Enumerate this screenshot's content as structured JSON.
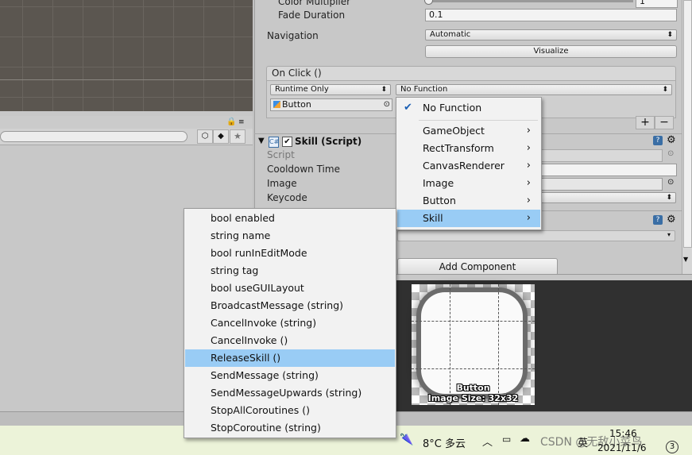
{
  "inspector": {
    "color_multiplier_label": "Color Multiplier",
    "color_multiplier_value": "1",
    "fade_duration_label": "Fade Duration",
    "fade_duration_value": "0.1",
    "navigation_label": "Navigation",
    "navigation_value": "Automatic",
    "visualize_label": "Visualize",
    "on_click_label": "On Click ()",
    "runtime_value": "Runtime Only",
    "function_value": "No Function",
    "object_value": "Button",
    "add_label": "+",
    "remove_label": "−",
    "component_title": "Skill (Script)",
    "fields": [
      "Script",
      "Cooldown Time",
      "Image",
      "Keycode"
    ],
    "add_component_label": "Add Component"
  },
  "function_menu": {
    "checked_item": "No Function",
    "items": [
      "GameObject",
      "RectTransform",
      "CanvasRenderer",
      "Image",
      "Button",
      "Skill"
    ],
    "selected_index": 5
  },
  "method_menu": {
    "items": [
      "bool enabled",
      "string name",
      "bool runInEditMode",
      "string tag",
      "bool useGUILayout",
      "BroadcastMessage (string)",
      "CancelInvoke (string)",
      "CancelInvoke ()",
      "ReleaseSkill ()",
      "SendMessage (string)",
      "SendMessageUpwards (string)",
      "StopAllCoroutines ()",
      "StopCoroutine (string)"
    ],
    "selected_index": 8
  },
  "preview": {
    "name": "Button",
    "size": "Image Size: 32x32"
  },
  "taskbar": {
    "weather": "8°C 多云",
    "input_method": "英",
    "watermark": "CSDN @无敌小菜鸟",
    "time": "15:46",
    "date": "2021/11/6",
    "notifications": "3"
  }
}
